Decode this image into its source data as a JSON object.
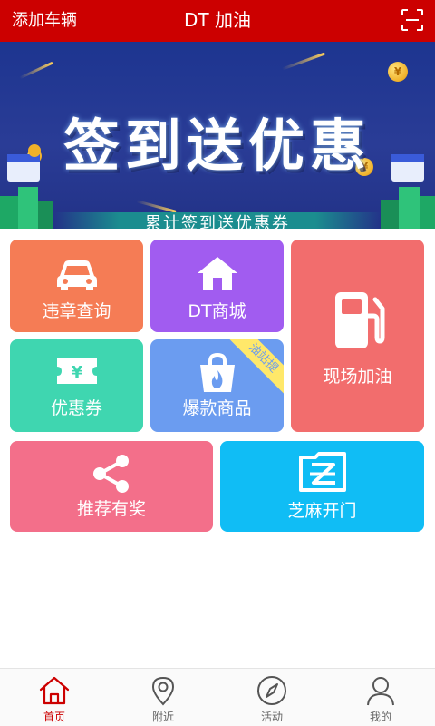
{
  "header": {
    "left_action": "添加车辆",
    "title": "DT 加油",
    "scan_icon": "scan-icon",
    "background": "#cc0000"
  },
  "banner": {
    "title": "签到送优惠",
    "subtitle": "累计签到送优惠券",
    "coin_symbol": "¥"
  },
  "tiles": [
    {
      "key": "violation",
      "label": "违章查询",
      "icon": "car-icon",
      "color": "#f57c55"
    },
    {
      "key": "mall",
      "label": "DT商城",
      "icon": "home-icon",
      "color": "#a15cf0"
    },
    {
      "key": "refuel",
      "label": "现场加油",
      "icon": "fuel-pump-icon",
      "color": "#f26d6d"
    },
    {
      "key": "coupon",
      "label": "优惠券",
      "icon": "coupon-ticket-icon",
      "color": "#3fd6b0",
      "icon_text": "¥"
    },
    {
      "key": "hot",
      "label": "爆款商品",
      "icon": "shopping-bag-icon",
      "color": "#6b9cf0",
      "ribbon": "油站提"
    },
    {
      "key": "referral",
      "label": "推荐有奖",
      "icon": "share-icon",
      "color": "#f36f8a"
    },
    {
      "key": "zhima",
      "label": "芝麻开门",
      "icon": "zhima-door-icon",
      "color": "#10bdf5"
    }
  ],
  "nav": {
    "items": [
      {
        "label": "首页",
        "icon": "home-outline-icon",
        "active": true
      },
      {
        "label": "附近",
        "icon": "location-pin-icon",
        "active": false
      },
      {
        "label": "活动",
        "icon": "compass-icon",
        "active": false
      },
      {
        "label": "我的",
        "icon": "user-icon",
        "active": false
      }
    ],
    "active_color": "#cc0000"
  }
}
